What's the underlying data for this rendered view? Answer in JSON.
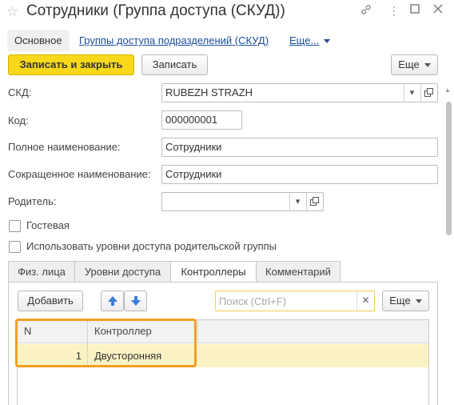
{
  "window": {
    "title": "Сотрудники (Группа доступа (СКУД))",
    "icons": [
      "star-icon",
      "link-icon",
      "more-icon",
      "maximize-icon",
      "close-icon"
    ]
  },
  "nav": {
    "active": "Основное",
    "link1": "Группы доступа подразделений (СКУД)",
    "more": "Еще..."
  },
  "toolbar": {
    "save_close": "Записать и закрыть",
    "save": "Записать",
    "more": "Еще"
  },
  "form": {
    "skd_label": "СКД:",
    "skd_value": "RUBEZH STRAZH",
    "code_label": "Код:",
    "code_value": "000000001",
    "fullname_label": "Полное наименование:",
    "fullname_value": "Сотрудники",
    "shortname_label": "Сокращенное наименование:",
    "shortname_value": "Сотрудники",
    "parent_label": "Родитель:",
    "parent_value": "",
    "guest_label": "Гостевая",
    "guest_checked": false,
    "use_parent_label": "Использовать уровни доступа родительской группы",
    "use_parent_checked": false
  },
  "tabs": [
    {
      "label": "Физ. лица",
      "active": false
    },
    {
      "label": "Уровни доступа",
      "active": false
    },
    {
      "label": "Контроллеры",
      "active": true
    },
    {
      "label": "Комментарий",
      "active": false
    }
  ],
  "panel": {
    "add": "Добавить",
    "search_placeholder": "Поиск (Ctrl+F)",
    "search_value": "",
    "more": "Еще"
  },
  "table": {
    "columns": [
      "N",
      "Контроллер"
    ],
    "rows": [
      {
        "n": "1",
        "controller": "Двусторонняя"
      }
    ]
  },
  "colors": {
    "primary_button": "#f7d81b",
    "link": "#1a4d9e",
    "selected_row": "#fbf2c4",
    "highlight_border": "#f29f22",
    "search_border": "#f2cf4d"
  }
}
